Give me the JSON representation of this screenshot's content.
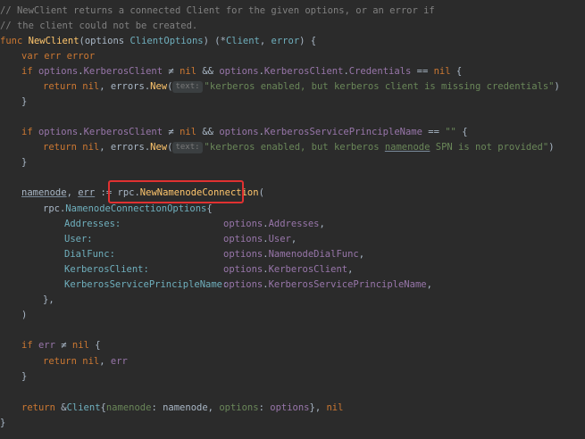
{
  "lines": {
    "l1": {
      "comment": "// NewClient returns a connected Client for the given options, or an error if"
    },
    "l2": {
      "comment": "// the client could not be created."
    },
    "l3": {
      "func": "func",
      "name": "NewClient",
      "open": "(",
      "param": "options",
      "ptype": "ClientOptions",
      "close": ") (*",
      "ret1": "Client",
      "sep": ", ",
      "ret2": "error",
      "end": ") {"
    },
    "l4": {
      "var": "var",
      "n1": "err",
      "n2": "error"
    },
    "l5": {
      "if": "if",
      "o": "options",
      "dot1": ".",
      "f1": "KerberosClient",
      "neq": " ≠ ",
      "nil1": "nil",
      "and": " && ",
      "o2": "options",
      "dot2": ".",
      "f2": "KerberosClient",
      "dot3": ".",
      "f3": "Credentials",
      "eq": " == ",
      "nil2": "nil",
      "brace": " {"
    },
    "l6": {
      "ret": "return",
      "nil": "nil",
      "comma": ", ",
      "pkg": "errors",
      "dot": ".",
      "fn": "New",
      "paren": "(",
      "hint": "text:",
      "str": "\"kerberos enabled, but kerberos client is missing credentials\"",
      "close": ")"
    },
    "l7": {
      "brace": "}"
    },
    "l8": {
      "if": "if",
      "o": "options",
      "dot1": ".",
      "f1": "KerberosClient",
      "neq": " ≠ ",
      "nil1": "nil",
      "and": " && ",
      "o2": "options",
      "dot2": ".",
      "f2": "KerberosServicePrincipleName",
      "eq": " == ",
      "str": "\"\"",
      "brace": " {"
    },
    "l9": {
      "ret": "return",
      "nil": "nil",
      "comma": ", ",
      "pkg": "errors",
      "dot": ".",
      "fn": "New",
      "paren": "(",
      "hint": "text:",
      "str_a": "\"kerberos enabled, but kerberos ",
      "str_u": "namenode",
      "str_b": " SPN is not provided\"",
      "close": ")"
    },
    "l10": {
      "brace": "}"
    },
    "l11": {
      "v1": "namenode",
      "comma": ", ",
      "v2": "err",
      "assign": " := ",
      "pkg": "rpc",
      "dot": ".",
      "fn": "NewNamenodeConnection",
      "paren": "("
    },
    "l12": {
      "pkg": "rpc",
      "dot": ".",
      "type": "NamenodeConnectionOptions",
      "brace": "{"
    },
    "fields": [
      {
        "key": "Addresses:",
        "val_obj": "options",
        "dot": ".",
        "val_f": "Addresses",
        "end": ","
      },
      {
        "key": "User:",
        "val_obj": "options",
        "dot": ".",
        "val_f": "User",
        "end": ","
      },
      {
        "key": "DialFunc:",
        "val_obj": "options",
        "dot": ".",
        "val_f": "NamenodeDialFunc",
        "end": ","
      },
      {
        "key": "KerberosClient:",
        "val_obj": "options",
        "dot": ".",
        "val_f": "KerberosClient",
        "end": ","
      },
      {
        "key": "KerberosServicePrincipleName:",
        "val_obj": "options",
        "dot": ".",
        "val_f": "KerberosServicePrincipleName",
        "end": ","
      }
    ],
    "l18": {
      "text": "},"
    },
    "l19": {
      "text": ")"
    },
    "l20": {
      "if": "if",
      "err": "err",
      "neq": " ≠ ",
      "nil": "nil",
      "brace": " {"
    },
    "l21": {
      "ret": "return",
      "nil": "nil",
      "comma": ", ",
      "err": "err"
    },
    "l22": {
      "brace": "}"
    },
    "l23": {
      "ret": "return",
      "amp": " &",
      "type": "Client",
      "open": "{",
      "k1": "namenode",
      "c1": ": ",
      "v1": "namenode",
      "s1": ", ",
      "k2": "options",
      "c2": ": ",
      "v2": "options",
      "close": "}, ",
      "nil": "nil"
    },
    "l24": {
      "brace": "}"
    }
  },
  "colors": {
    "highlight_border": "#e03131",
    "background": "#2b2b2b"
  }
}
